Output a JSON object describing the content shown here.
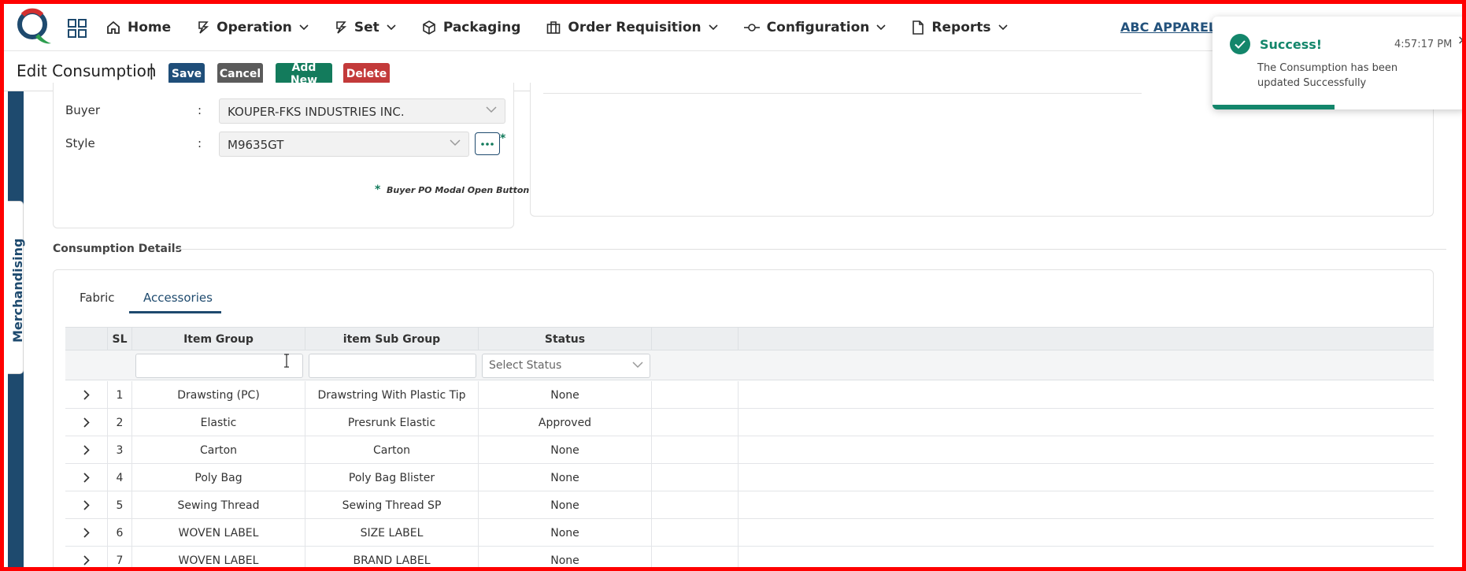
{
  "nav": {
    "items": [
      {
        "label": "Home",
        "icon": "home-icon",
        "dropdown": false
      },
      {
        "label": "Operation",
        "icon": "operation-icon",
        "dropdown": true
      },
      {
        "label": "Set",
        "icon": "set-icon",
        "dropdown": true
      },
      {
        "label": "Packaging",
        "icon": "package-icon",
        "dropdown": false
      },
      {
        "label": "Order Requisition",
        "icon": "briefcase-icon",
        "dropdown": true
      },
      {
        "label": "Configuration",
        "icon": "config-icon",
        "dropdown": true
      },
      {
        "label": "Reports",
        "icon": "report-icon",
        "dropdown": true
      }
    ],
    "company": "ABC APPARELS L"
  },
  "toolbar": {
    "title": "Edit Consumption",
    "separator": "|",
    "save_label": "Save",
    "cancel_label": "Cancel",
    "add_label": "Add New",
    "delete_label": "Delete"
  },
  "sidebar": {
    "tab_label": "Merchandising"
  },
  "form": {
    "buyer_label": "Buyer",
    "buyer_value": "KOUPER-FKS INDUSTRIES INC.",
    "style_label": "Style",
    "style_value": "M9635GT",
    "colon": ":",
    "required_mark": "*",
    "note": "Buyer PO Modal Open Button"
  },
  "details": {
    "section_title": "Consumption Details",
    "tabs": [
      "Fabric",
      "Accessories"
    ],
    "active_tab": "Accessories",
    "columns": [
      "SL",
      "Item Group",
      "item Sub Group",
      "Status"
    ],
    "status_placeholder": "Select Status",
    "rows": [
      {
        "sl": "1",
        "group": "Drawsting (PC)",
        "sub_group": "Drawstring With Plastic Tip",
        "status": "None"
      },
      {
        "sl": "2",
        "group": "Elastic",
        "sub_group": "Presrunk Elastic",
        "status": "Approved"
      },
      {
        "sl": "3",
        "group": "Carton",
        "sub_group": "Carton",
        "status": "None"
      },
      {
        "sl": "4",
        "group": "Poly Bag",
        "sub_group": "Poly Bag Blister",
        "status": "None"
      },
      {
        "sl": "5",
        "group": "Sewing Thread",
        "sub_group": "Sewing Thread SP",
        "status": "None"
      },
      {
        "sl": "6",
        "group": "WOVEN LABEL",
        "sub_group": "SIZE LABEL",
        "status": "None"
      },
      {
        "sl": "7",
        "group": "WOVEN LABEL",
        "sub_group": "BRAND LABEL",
        "status": "None"
      }
    ]
  },
  "toast": {
    "title": "Success!",
    "time": "4:57:17 PM",
    "message": "The Consumption has been updated Successfully",
    "close": "×",
    "progress": 0.48
  },
  "colors": {
    "primary": "#1f4e79",
    "success": "#13866b",
    "danger": "#c33a3a",
    "neutral": "#5b5b5b",
    "frame": "#ff0000"
  }
}
